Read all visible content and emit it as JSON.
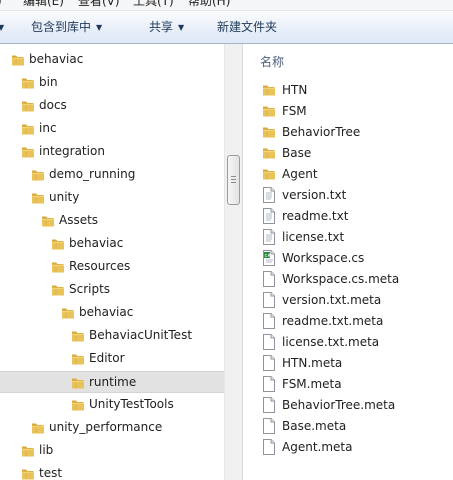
{
  "menubar": {
    "items": [
      {
        "label": "编辑(E)"
      },
      {
        "label": "查看(V)"
      },
      {
        "label": "工具(T)"
      },
      {
        "label": "帮助(H)"
      }
    ]
  },
  "toolbar": {
    "include_in_library": "包含到库中",
    "share": "共享",
    "new_folder": "新建文件夹"
  },
  "nav_tree": [
    {
      "label": "behaviac",
      "depth": 0
    },
    {
      "label": "bin",
      "depth": 1
    },
    {
      "label": "docs",
      "depth": 1
    },
    {
      "label": "inc",
      "depth": 1
    },
    {
      "label": "integration",
      "depth": 1
    },
    {
      "label": "demo_running",
      "depth": 2
    },
    {
      "label": "unity",
      "depth": 2
    },
    {
      "label": "Assets",
      "depth": 3
    },
    {
      "label": "behaviac",
      "depth": 4
    },
    {
      "label": "Resources",
      "depth": 4
    },
    {
      "label": "Scripts",
      "depth": 4
    },
    {
      "label": "behaviac",
      "depth": 5
    },
    {
      "label": "BehaviacUnitTest",
      "depth": 6
    },
    {
      "label": "Editor",
      "depth": 6
    },
    {
      "label": "runtime",
      "depth": 6,
      "selected": true
    },
    {
      "label": "UnityTestTools",
      "depth": 6
    },
    {
      "label": "unity_performance",
      "depth": 2
    },
    {
      "label": "lib",
      "depth": 1
    },
    {
      "label": "test",
      "depth": 1
    }
  ],
  "file_list": {
    "column_header": "名称",
    "items": [
      {
        "name": "HTN",
        "icon": "folder-icon"
      },
      {
        "name": "FSM",
        "icon": "folder-icon"
      },
      {
        "name": "BehaviorTree",
        "icon": "folder-icon"
      },
      {
        "name": "Base",
        "icon": "folder-icon"
      },
      {
        "name": "Agent",
        "icon": "folder-icon"
      },
      {
        "name": "version.txt",
        "icon": "text-file-icon"
      },
      {
        "name": "readme.txt",
        "icon": "text-file-icon"
      },
      {
        "name": "license.txt",
        "icon": "text-file-icon"
      },
      {
        "name": "Workspace.cs",
        "icon": "csharp-file-icon"
      },
      {
        "name": "Workspace.cs.meta",
        "icon": "blank-file-icon"
      },
      {
        "name": "version.txt.meta",
        "icon": "blank-file-icon"
      },
      {
        "name": "readme.txt.meta",
        "icon": "blank-file-icon"
      },
      {
        "name": "license.txt.meta",
        "icon": "blank-file-icon"
      },
      {
        "name": "HTN.meta",
        "icon": "blank-file-icon"
      },
      {
        "name": "FSM.meta",
        "icon": "blank-file-icon"
      },
      {
        "name": "BehaviorTree.meta",
        "icon": "blank-file-icon"
      },
      {
        "name": "Base.meta",
        "icon": "blank-file-icon"
      },
      {
        "name": "Agent.meta",
        "icon": "blank-file-icon"
      }
    ]
  },
  "colors": {
    "folder": "#e9c25a",
    "selection": "#e2e2e2",
    "toolbar_text": "#1e395b",
    "header_text": "#4c607a"
  }
}
